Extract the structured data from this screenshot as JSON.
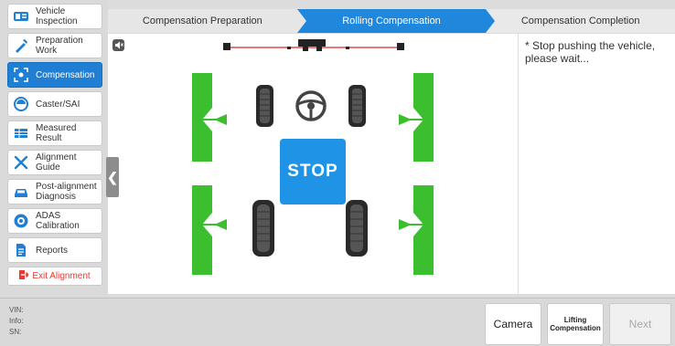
{
  "sidebar": {
    "items": [
      {
        "label": "Vehicle Inspection",
        "icon": "vehicle-inspection-icon",
        "active": false
      },
      {
        "label": "Preparation Work",
        "icon": "preparation-icon",
        "active": false
      },
      {
        "label": "Compensation",
        "icon": "compensation-icon",
        "active": true
      },
      {
        "label": "Caster/SAI",
        "icon": "caster-icon",
        "active": false
      },
      {
        "label": "Measured Result",
        "icon": "measured-result-icon",
        "active": false
      },
      {
        "label": "Alignment Guide",
        "icon": "alignment-guide-icon",
        "active": false
      },
      {
        "label": "Post-alignment Diagnosis",
        "icon": "car-icon",
        "active": false
      },
      {
        "label": "ADAS Calibration",
        "icon": "adas-icon",
        "active": false
      },
      {
        "label": "Reports",
        "icon": "report-icon",
        "active": false
      }
    ],
    "exit_label": "Exit Alignment"
  },
  "steps": [
    {
      "label": "Compensation Preparation",
      "state": "done"
    },
    {
      "label": "Rolling Compensation",
      "state": "current"
    },
    {
      "label": "Compensation Completion",
      "state": "pending"
    }
  ],
  "main": {
    "stop_label": "STOP",
    "message": "* Stop pushing the vehicle, please wait..."
  },
  "bottom": {
    "vin_label": "VIN:",
    "info_label": "Info:",
    "sn_label": "SN:",
    "camera_label": "Camera",
    "lifting_label": "Lifting Compensation",
    "next_label": "Next"
  },
  "colors": {
    "accent": "#1e7fd4",
    "target_green": "#3bbf2f",
    "exit_red": "#e83a31"
  }
}
